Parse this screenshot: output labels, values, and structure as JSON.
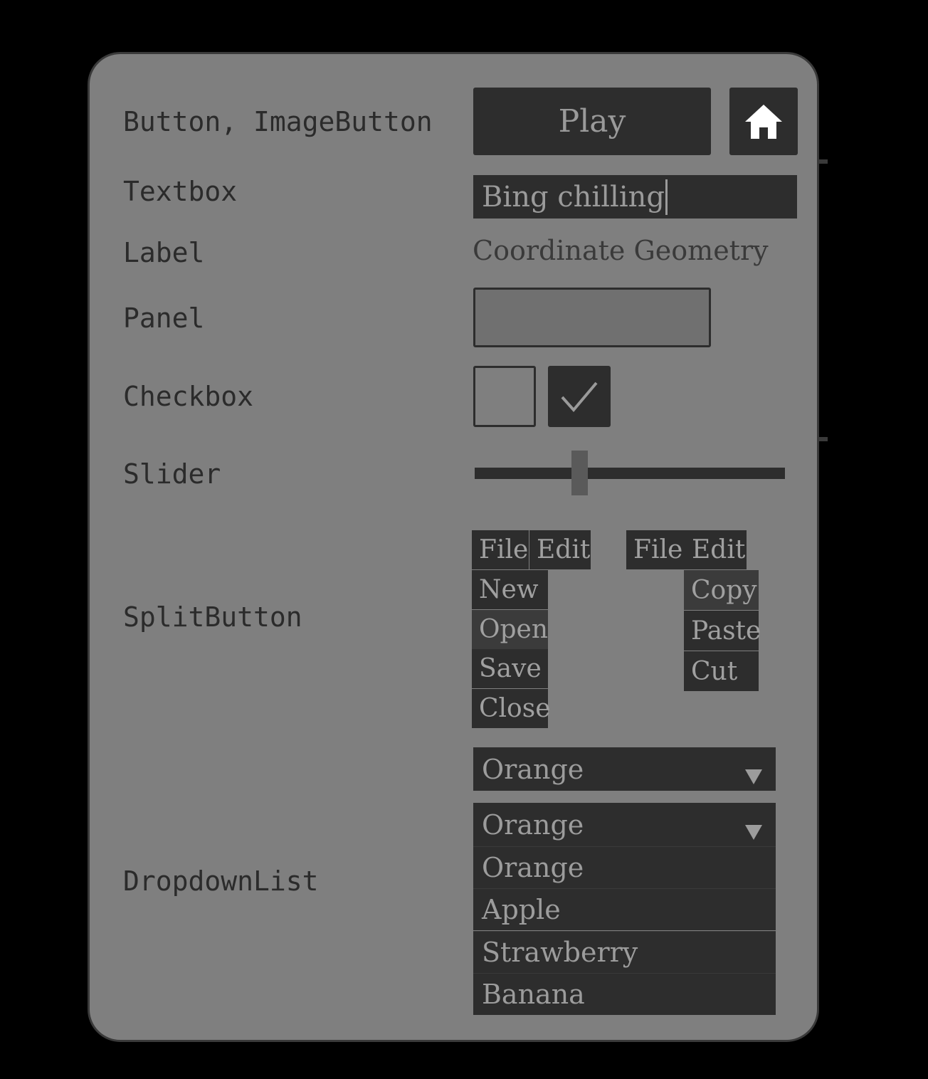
{
  "rows": {
    "button": "Button, ImageButton",
    "textbox": "Textbox",
    "label": "Label",
    "panel": "Panel",
    "checkbox": "Checkbox",
    "slider": "Slider",
    "splitbutton": "SplitButton",
    "dropdown": "DropdownList"
  },
  "button": {
    "play_label": "Play",
    "image_icon": "home-icon"
  },
  "textbox": {
    "value": "Bing chilling"
  },
  "label": {
    "text": "Coordinate Geometry"
  },
  "checkbox": {
    "unchecked": false,
    "checked": true,
    "check_icon": "checkmark-icon"
  },
  "slider": {
    "value_fraction": 0.32
  },
  "splitbutton_a": {
    "top": [
      "File",
      "Edit"
    ],
    "items": [
      "New",
      "Open",
      "Save",
      "Close"
    ],
    "highlighted": "Open"
  },
  "splitbutton_b": {
    "top": [
      "File",
      "Edit"
    ],
    "items": [
      "Copy",
      "Paste",
      "Cut"
    ],
    "highlighted": "Copy"
  },
  "dropdown_closed": {
    "selected": "Orange",
    "arrow": "▼"
  },
  "dropdown_open": {
    "selected": "Orange",
    "arrow": "▼",
    "options": [
      "Orange",
      "Apple",
      "Strawberry",
      "Banana"
    ]
  }
}
